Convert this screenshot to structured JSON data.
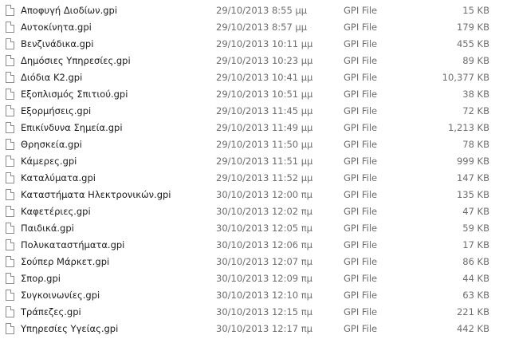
{
  "files": [
    {
      "name": "Αποφυγή Διοδίων.gpi",
      "date": "29/10/2013 8:55 μμ",
      "type": "GPI File",
      "size": "15 KB"
    },
    {
      "name": "Αυτοκίνητα.gpi",
      "date": "29/10/2013 8:57 μμ",
      "type": "GPI File",
      "size": "179 KB"
    },
    {
      "name": "Βενζινάδικα.gpi",
      "date": "29/10/2013 10:11 μμ",
      "type": "GPI File",
      "size": "455 KB"
    },
    {
      "name": "Δημόσιες Υπηρεσίες.gpi",
      "date": "29/10/2013 10:23 μμ",
      "type": "GPI File",
      "size": "89 KB"
    },
    {
      "name": "Διόδια Κ2.gpi",
      "date": "29/10/2013 10:41 μμ",
      "type": "GPI File",
      "size": "10,377 KB"
    },
    {
      "name": "Εξοπλισμός Σπιτιού.gpi",
      "date": "29/10/2013 10:51 μμ",
      "type": "GPI File",
      "size": "38 KB"
    },
    {
      "name": "Εξορμήσεις.gpi",
      "date": "29/10/2013 11:45 μμ",
      "type": "GPI File",
      "size": "72 KB"
    },
    {
      "name": "Επικίνδυνα Σημεία.gpi",
      "date": "29/10/2013 11:49 μμ",
      "type": "GPI File",
      "size": "1,213 KB"
    },
    {
      "name": "Θρησκεία.gpi",
      "date": "29/10/2013 11:50 μμ",
      "type": "GPI File",
      "size": "78 KB"
    },
    {
      "name": "Κάμερες.gpi",
      "date": "29/10/2013 11:51 μμ",
      "type": "GPI File",
      "size": "999 KB"
    },
    {
      "name": "Καταλύματα.gpi",
      "date": "29/10/2013 11:52 μμ",
      "type": "GPI File",
      "size": "147 KB"
    },
    {
      "name": "Καταστήματα Ηλεκτρονικών.gpi",
      "date": "30/10/2013 12:00 πμ",
      "type": "GPI File",
      "size": "135 KB"
    },
    {
      "name": "Καφετέριες.gpi",
      "date": "30/10/2013 12:02 πμ",
      "type": "GPI File",
      "size": "47 KB"
    },
    {
      "name": "Παιδικά.gpi",
      "date": "30/10/2013 12:05 πμ",
      "type": "GPI File",
      "size": "59 KB"
    },
    {
      "name": "Πολυκαταστήματα.gpi",
      "date": "30/10/2013 12:06 πμ",
      "type": "GPI File",
      "size": "17 KB"
    },
    {
      "name": "Σούπερ Μάρκετ.gpi",
      "date": "30/10/2013 12:07 πμ",
      "type": "GPI File",
      "size": "86 KB"
    },
    {
      "name": "Σπορ.gpi",
      "date": "30/10/2013 12:09 πμ",
      "type": "GPI File",
      "size": "44 KB"
    },
    {
      "name": "Συγκοινωνίες.gpi",
      "date": "30/10/2013 12:10 πμ",
      "type": "GPI File",
      "size": "63 KB"
    },
    {
      "name": "Τράπεζες.gpi",
      "date": "30/10/2013 12:15 πμ",
      "type": "GPI File",
      "size": "221 KB"
    },
    {
      "name": "Υπηρεσίες Υγείας.gpi",
      "date": "30/10/2013 12:17 πμ",
      "type": "GPI File",
      "size": "442 KB"
    }
  ],
  "icons": {
    "file": "file-icon"
  }
}
